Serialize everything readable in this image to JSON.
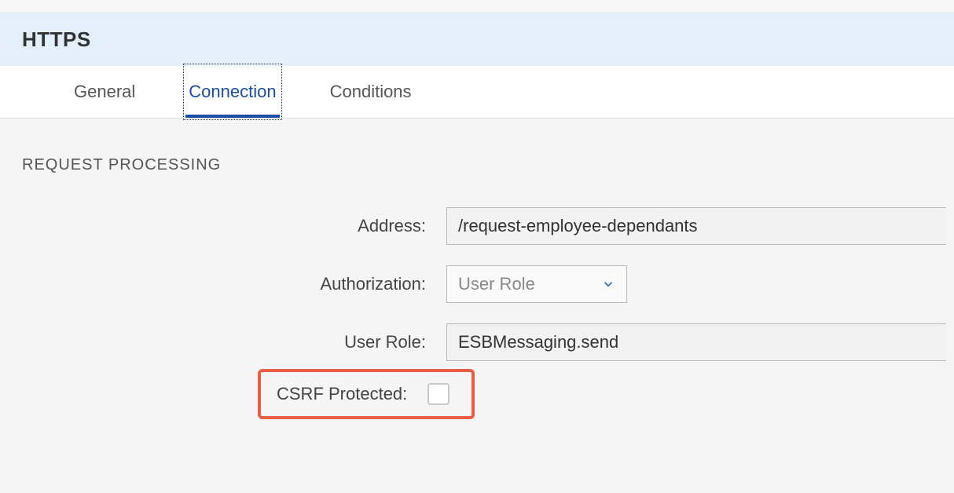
{
  "header": {
    "title": "HTTPS"
  },
  "tabs": {
    "general": "General",
    "connection": "Connection",
    "conditions": "Conditions"
  },
  "section": {
    "title": "REQUEST PROCESSING"
  },
  "form": {
    "address_label": "Address:",
    "address_value": "/request-employee-dependants",
    "authorization_label": "Authorization:",
    "authorization_value": "User Role",
    "user_role_label": "User Role:",
    "user_role_value": "ESBMessaging.send",
    "csrf_label": "CSRF Protected:"
  }
}
